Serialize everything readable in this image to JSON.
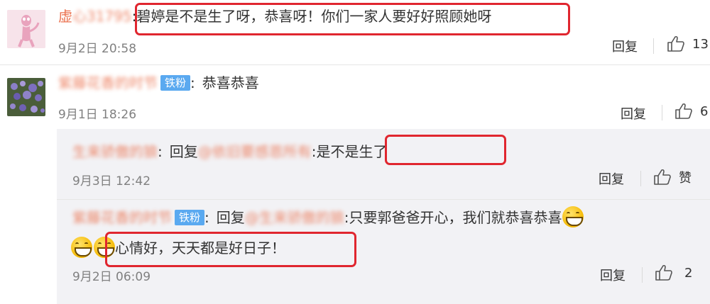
{
  "comments": [
    {
      "user": "虚心31795",
      "colon": ":",
      "text": "碧婷是不是生了呀，恭喜呀！你们一家人要好好照顾她呀",
      "time": "9月2日 20:58",
      "reply_label": "回复",
      "like_count": "13"
    },
    {
      "user": "紫藤花香的时节",
      "badge": "铁粉",
      "colon": ":",
      "text": "恭喜恭喜",
      "time": "9月1日 18:26",
      "reply_label": "回复",
      "like_count": "6"
    }
  ],
  "replies": [
    {
      "user": "生来骄傲的狼",
      "colon": ":",
      "reply_prefix": "回复",
      "mention": "@依旧要感恩所有",
      "text": ":是不是生了",
      "time": "9月3日 12:42",
      "reply_label": "回复",
      "like_label": "赞"
    },
    {
      "user": "紫藤花香的时节",
      "badge": "铁粉",
      "colon": ":",
      "reply_prefix": "回复",
      "mention": "@生来骄傲的狼",
      "text": ":只要郭爸爸开心，我们就恭喜恭喜",
      "text2": "心情好，天天都是好日子！",
      "time": "9月2日 06:09",
      "reply_label": "回复",
      "like_count": "2"
    }
  ],
  "icons": {
    "like": "thumbs-up-icon",
    "emoji": "grin-emoji-icon"
  },
  "colors": {
    "username": "#eb7350",
    "badge_bg": "#5aa9f0",
    "highlight_box": "#e0262f",
    "sub_panel_bg": "#f2f2f5",
    "meta_text": "#808080"
  }
}
